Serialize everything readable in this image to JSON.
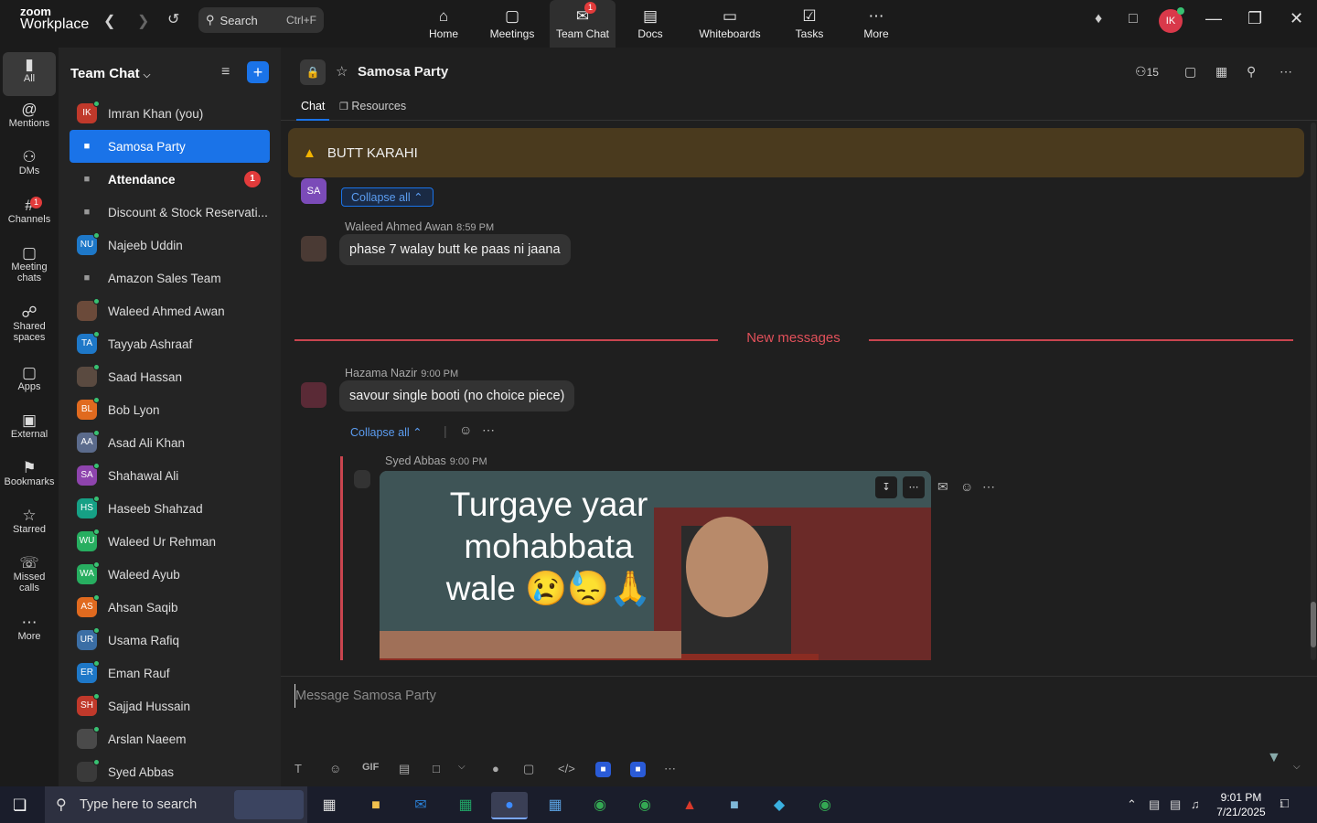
{
  "app": {
    "brand_line1": "zoom",
    "brand_line2": "Workplace"
  },
  "topbar": {
    "search_label": "Search",
    "search_shortcut": "Ctrl+F",
    "nav": [
      {
        "label": "Home",
        "icon": "home-icon"
      },
      {
        "label": "Meetings",
        "icon": "video-icon"
      },
      {
        "label": "Team Chat",
        "icon": "chat-icon",
        "badge": "1"
      },
      {
        "label": "Docs",
        "icon": "doc-icon"
      },
      {
        "label": "Whiteboards",
        "icon": "whiteboard-icon"
      },
      {
        "label": "Tasks",
        "icon": "tasks-icon"
      },
      {
        "label": "More",
        "icon": "more-icon"
      }
    ],
    "avatar_initials": "IK"
  },
  "rail": [
    {
      "label": "All",
      "icon": "chat-bubble-icon"
    },
    {
      "label": "Mentions",
      "icon": "at-icon"
    },
    {
      "label": "DMs",
      "icon": "people-icon"
    },
    {
      "label": "Channels",
      "icon": "hash-icon",
      "badge": "1"
    },
    {
      "label": "Meeting chats",
      "icon": "meeting-chat-icon"
    },
    {
      "label": "Shared spaces",
      "icon": "shared-icon"
    },
    {
      "label": "Apps",
      "icon": "apps-icon"
    },
    {
      "label": "External",
      "icon": "external-icon"
    },
    {
      "label": "Bookmarks",
      "icon": "bookmark-icon"
    },
    {
      "label": "Starred",
      "icon": "star-icon"
    },
    {
      "label": "Missed calls",
      "icon": "missed-call-icon"
    },
    {
      "label": "More",
      "icon": "more-icon"
    }
  ],
  "sidebar": {
    "title": "Team Chat",
    "items": [
      {
        "label": "Imran Khan (you)",
        "initials": "IK",
        "color": "#c0392b"
      },
      {
        "label": "Samosa Party",
        "lock": true,
        "selected": true
      },
      {
        "label": "Attendance",
        "lock": true,
        "bold": true,
        "count": "1"
      },
      {
        "label": "Discount & Stock Reservati...",
        "lock": true
      },
      {
        "label": "Najeeb Uddin",
        "initials": "NU",
        "color": "#1e78c8"
      },
      {
        "label": "Amazon Sales Team",
        "lock": true
      },
      {
        "label": "Waleed Ahmed Awan",
        "initials": "",
        "color": "#6b4a3a"
      },
      {
        "label": "Tayyab Ashraaf",
        "initials": "TA",
        "color": "#1e78c8"
      },
      {
        "label": "Saad Hassan",
        "initials": "",
        "color": "#5a4a40"
      },
      {
        "label": "Bob Lyon",
        "initials": "BL",
        "color": "#e06a1f"
      },
      {
        "label": "Asad Ali Khan",
        "initials": "AA",
        "color": "#5b6b8c"
      },
      {
        "label": "Shahawal Ali",
        "initials": "SA",
        "color": "#8e44ad"
      },
      {
        "label": "Haseeb Shahzad",
        "initials": "HS",
        "color": "#16a085"
      },
      {
        "label": "Waleed Ur Rehman",
        "initials": "WU",
        "color": "#27ae60"
      },
      {
        "label": "Waleed Ayub",
        "initials": "WA",
        "color": "#27ae60"
      },
      {
        "label": "Ahsan Saqib",
        "initials": "AS",
        "color": "#e06a1f"
      },
      {
        "label": "Usama Rafiq",
        "initials": "UR",
        "color": "#3b6ea5"
      },
      {
        "label": "Eman Rauf",
        "initials": "ER",
        "color": "#1e78c8"
      },
      {
        "label": "Sajjad Hussain",
        "initials": "SH",
        "color": "#c0392b"
      },
      {
        "label": "Arslan Naeem",
        "initials": "",
        "color": "#4a4a4a"
      },
      {
        "label": "Syed Abbas",
        "initials": "",
        "color": "#3a3a3a"
      }
    ]
  },
  "channel": {
    "name": "Samosa Party",
    "member_count": "15",
    "tabs": [
      "Chat",
      "Resources"
    ],
    "pinned": "BUTT KARAHI"
  },
  "messages": {
    "collapse_label": "Collapse all",
    "sa_initials": "SA",
    "m1": {
      "sender": "Waleed Ahmed Awan",
      "time": "8:59 PM",
      "text": "phase 7 walay butt ke paas ni jaana"
    },
    "divider": "New messages",
    "m2": {
      "sender": "Hazama Nazir",
      "time": "9:00 PM",
      "text": "savour single booti (no choice piece)"
    },
    "m3": {
      "sender": "Syed Abbas",
      "time": "9:00 PM",
      "image_caption": "Turgaye yaar mohabbata wale 😢😓🙏"
    }
  },
  "composer": {
    "placeholder": "Message Samosa Party",
    "gif": "GIF"
  },
  "taskbar": {
    "search_placeholder": "Type here to search",
    "time": "9:01 PM",
    "date": "7/21/2025",
    "notif_count": "1"
  },
  "colors": {
    "accent": "#1a73e8",
    "badge": "#e23b3b",
    "new_messages": "#e0505a",
    "pinned_bg": "#4a3a1e"
  }
}
